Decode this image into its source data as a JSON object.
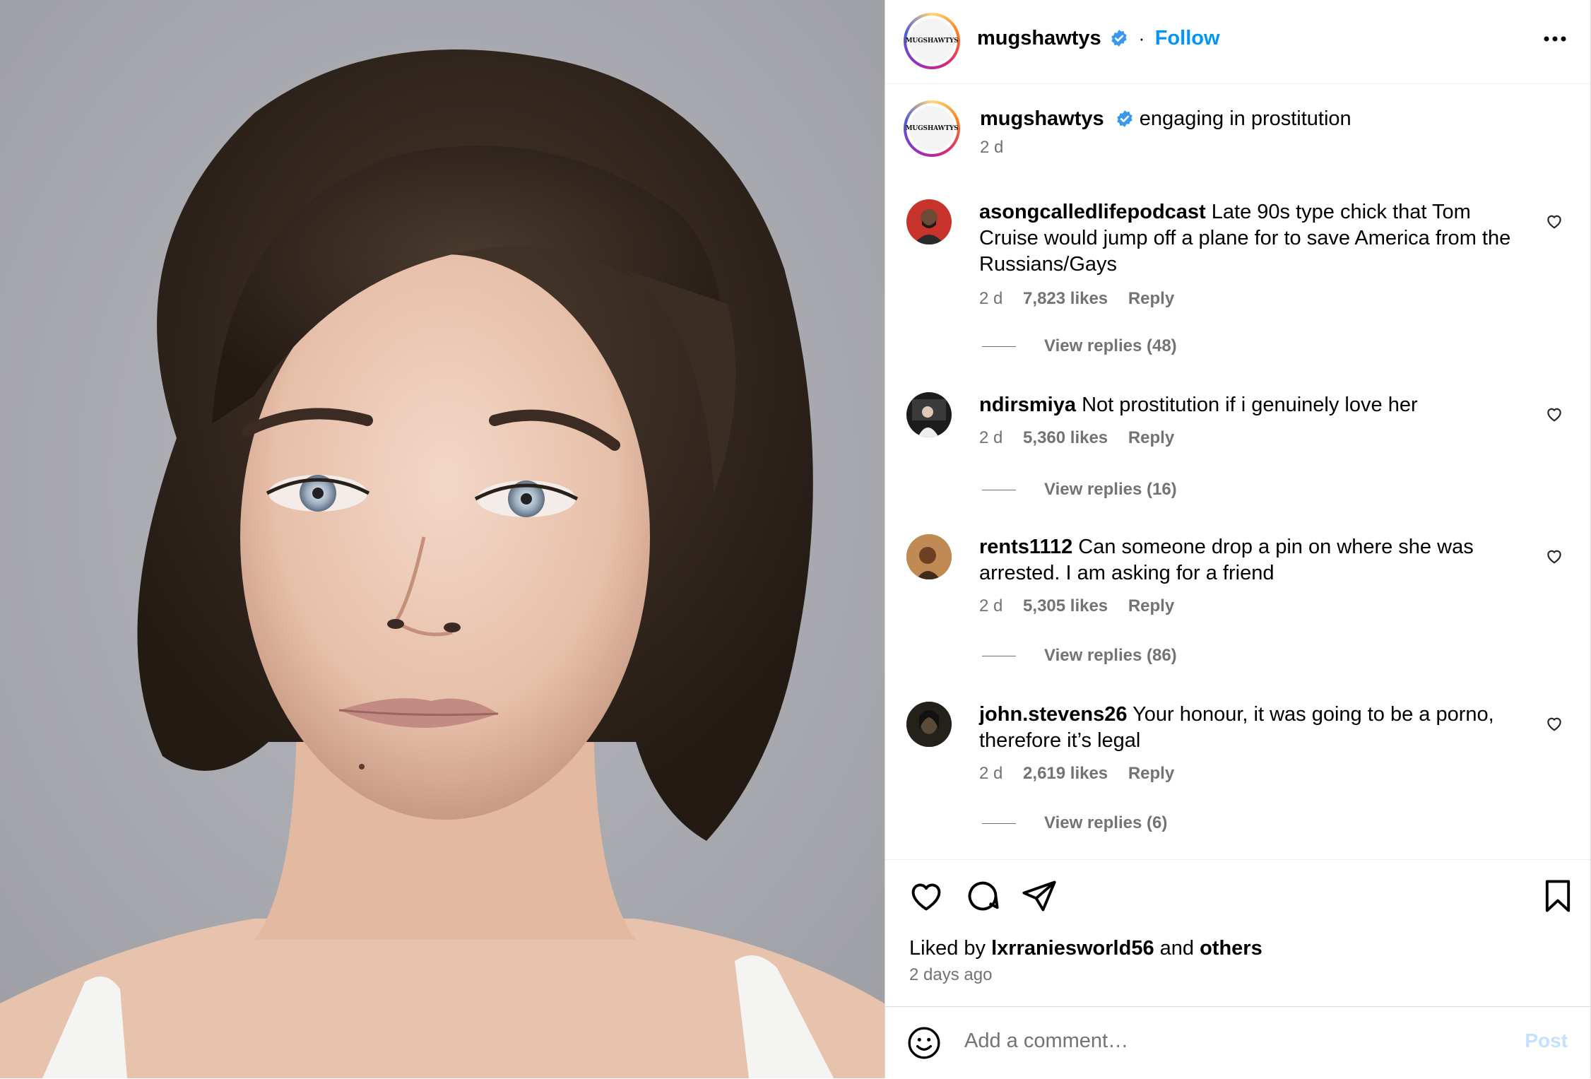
{
  "post": {
    "photo_alt": "Mugshot photo"
  },
  "header": {
    "logo_text": "MUGSHAWTYS",
    "username": "mugshawtys",
    "separator": "·",
    "follow_label": "Follow",
    "more_icon": "more-horizontal-icon"
  },
  "caption": {
    "username": "mugshawtys",
    "text": "engaging in prostitution",
    "time": "2 d"
  },
  "comments": [
    {
      "username": "asongcalledlifepodcast",
      "text": "Late 90s type chick that Tom Cruise would jump off a plane for to save America from the Russians/Gays",
      "time": "2 d",
      "likes": "7,823 likes",
      "reply": "Reply",
      "view_replies": "View replies (48)"
    },
    {
      "username": "ndirsmiya",
      "text": "Not prostitution if i genuinely love her",
      "time": "2 d",
      "likes": "5,360 likes",
      "reply": "Reply",
      "view_replies": "View replies (16)"
    },
    {
      "username": "rents1112",
      "text": "Can someone drop a pin on where she was arrested. I am asking for a friend",
      "time": "2 d",
      "likes": "5,305 likes",
      "reply": "Reply",
      "view_replies": "View replies (86)"
    },
    {
      "username": "john.stevens26",
      "text": "Your honour, it was going to be a porno, therefore it’s legal",
      "time": "2 d",
      "likes": "2,619 likes",
      "reply": "Reply",
      "view_replies": "View replies (6)"
    }
  ],
  "footer": {
    "liked_prefix": "Liked by",
    "liked_user": "lxrraniesworld56",
    "liked_and": "and",
    "liked_others": "others",
    "time_ago": "2 days ago",
    "comment_placeholder": "Add a comment…",
    "post_label": "Post"
  },
  "colors": {
    "accent": "#0095f6",
    "muted": "#737373",
    "post_disabled": "#c3e0fd"
  }
}
